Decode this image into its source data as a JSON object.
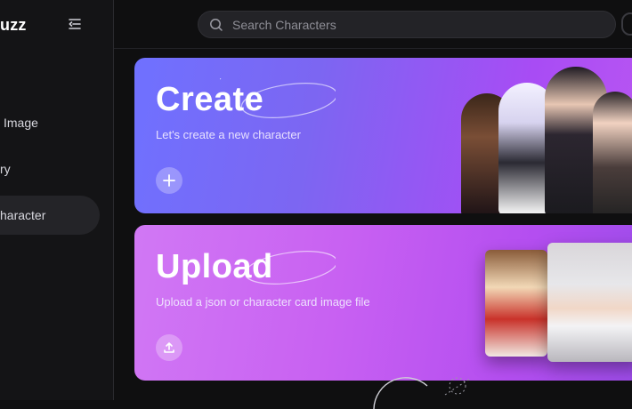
{
  "sidebar": {
    "brand": "uzz",
    "items": [
      {
        "label": "Image"
      },
      {
        "label": "ry"
      },
      {
        "label": "haracter"
      }
    ]
  },
  "header": {
    "search_placeholder": "Search Characters"
  },
  "cards": {
    "create": {
      "title": "Create",
      "subtitle": "Let's create a new character"
    },
    "upload": {
      "title": "Upload",
      "subtitle": "Upload a json or character card image file"
    }
  },
  "colors": {
    "background": "#0f0f10",
    "sidebar": "#141416",
    "create_gradient_start": "#6f71ff",
    "create_gradient_end": "#b956f2",
    "upload_gradient_start": "#d178f4",
    "upload_gradient_end": "#9d4cea"
  },
  "icons": {
    "collapse": "collapse-sidebar-icon",
    "search": "search-icon",
    "create": "plus-icon",
    "upload": "upload-icon"
  }
}
